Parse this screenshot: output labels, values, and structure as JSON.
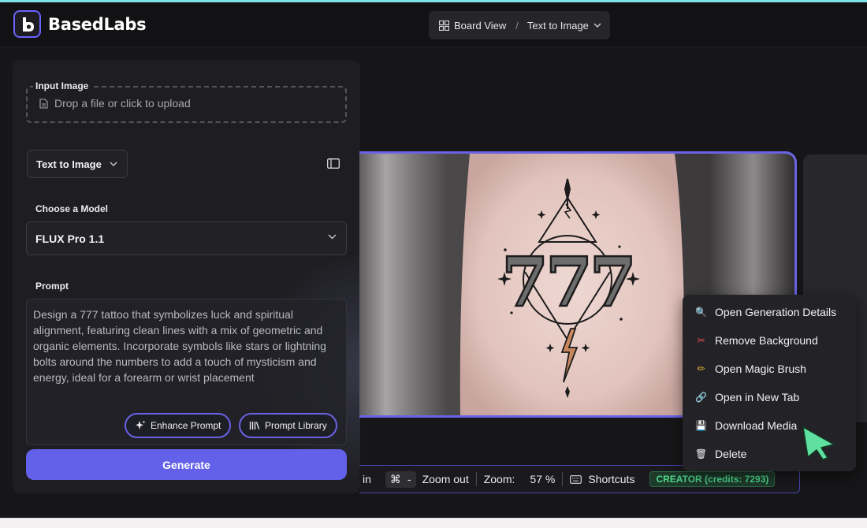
{
  "colors": {
    "accent": "#6360ea",
    "credits_green": "#4fd88a",
    "top_accent": "#7fe0e8"
  },
  "header": {
    "brand": "BasedLabs",
    "breadcrumb": {
      "board_view": "Board View",
      "separator": "/",
      "current": "Text to Image"
    }
  },
  "panel": {
    "input_image_label": "Input Image",
    "drop_placeholder": "Drop a file or click to upload",
    "mode_selected": "Text to Image",
    "model_label": "Choose a Model",
    "model_selected": "FLUX Pro 1.1",
    "prompt_label": "Prompt",
    "prompt_text": "Design a 777 tattoo that symbolizes luck and spiritual alignment, featuring clean lines with a mix of geometric and organic elements. Incorporate symbols like stars or lightning bolts around the numbers to add a touch of mysticism and energy, ideal for a forearm or wrist placement",
    "enhance_label": "Enhance Prompt",
    "library_label": "Prompt Library",
    "generate_label": "Generate"
  },
  "canvas": {
    "tattoo_text": "777"
  },
  "toolbar": {
    "zoom_in_fragment": "in",
    "zoom_out_key": "⌘",
    "zoom_out_key2": "-",
    "zoom_out_label": "Zoom out",
    "zoom_label": "Zoom:",
    "zoom_value": "57 %",
    "shortcuts_label": "Shortcuts",
    "credits_badge": "CREATOR (credits: 7293)"
  },
  "context_menu": {
    "items": [
      {
        "label": "Open Generation Details",
        "icon": "magnifier-icon"
      },
      {
        "label": "Remove Background",
        "icon": "scissors-icon"
      },
      {
        "label": "Open Magic Brush",
        "icon": "pencil-icon"
      },
      {
        "label": "Open in New Tab",
        "icon": "link-icon"
      },
      {
        "label": "Download Media",
        "icon": "floppy-icon"
      },
      {
        "label": "Delete",
        "icon": "trash-icon"
      }
    ]
  }
}
